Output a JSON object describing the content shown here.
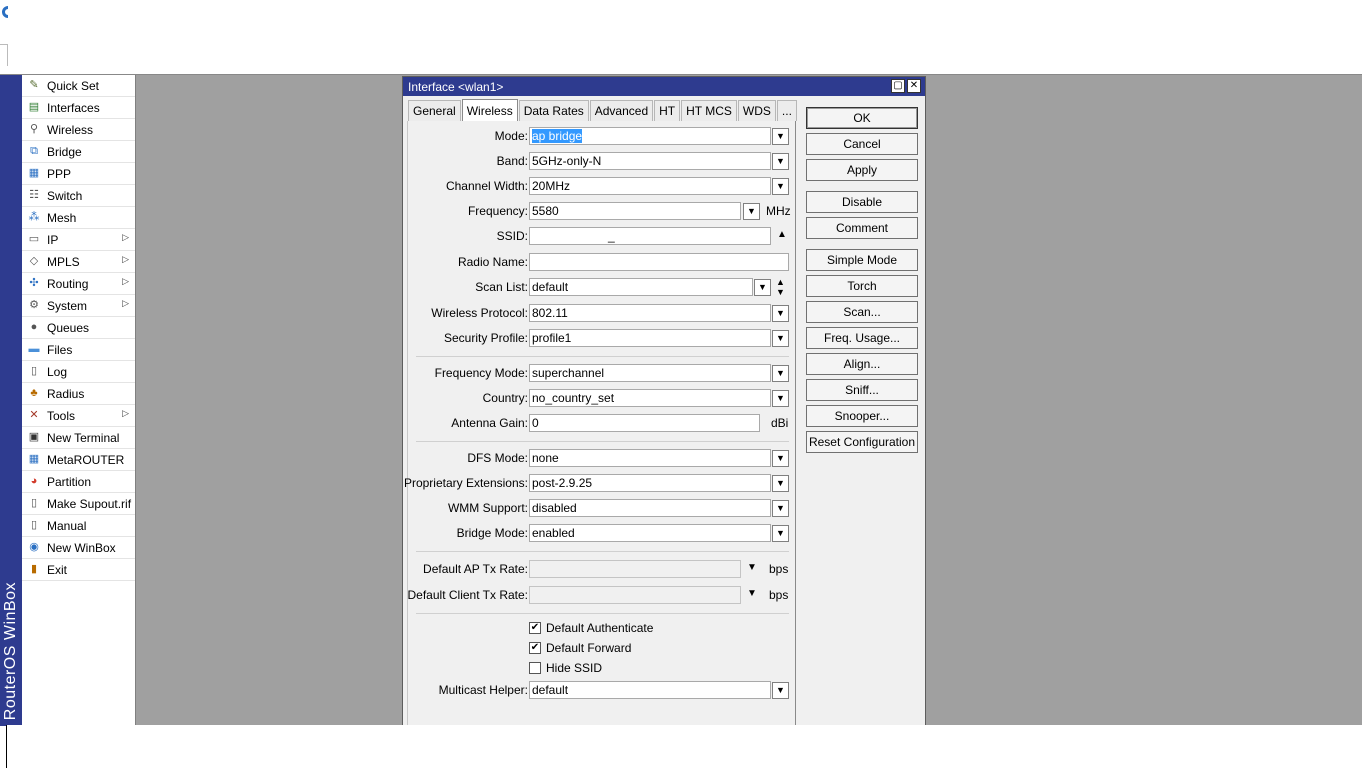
{
  "brand": "RouterOS WinBox",
  "menu": [
    {
      "label": "Quick Set",
      "icon": "quick-set-icon",
      "glyph": "✎",
      "color": "#556b2f",
      "arrow": false
    },
    {
      "label": "Interfaces",
      "icon": "interfaces-icon",
      "glyph": "▤",
      "color": "#2f7d32",
      "arrow": false
    },
    {
      "label": "Wireless",
      "icon": "wireless-icon",
      "glyph": "⚲",
      "color": "#555555",
      "arrow": false
    },
    {
      "label": "Bridge",
      "icon": "bridge-icon",
      "glyph": "⧉",
      "color": "#2a6fc2",
      "arrow": false
    },
    {
      "label": "PPP",
      "icon": "ppp-icon",
      "glyph": "▦",
      "color": "#2a6fc2",
      "arrow": false
    },
    {
      "label": "Switch",
      "icon": "switch-icon",
      "glyph": "☷",
      "color": "#555555",
      "arrow": false
    },
    {
      "label": "Mesh",
      "icon": "mesh-icon",
      "glyph": "⁂",
      "color": "#2a6fc2",
      "arrow": false
    },
    {
      "label": "IP",
      "icon": "ip-icon",
      "glyph": "▭",
      "color": "#555555",
      "arrow": true
    },
    {
      "label": "MPLS",
      "icon": "mpls-icon",
      "glyph": "◇",
      "color": "#555555",
      "arrow": true
    },
    {
      "label": "Routing",
      "icon": "routing-icon",
      "glyph": "✣",
      "color": "#2a6fc2",
      "arrow": true
    },
    {
      "label": "System",
      "icon": "system-icon",
      "glyph": "⚙",
      "color": "#555555",
      "arrow": true
    },
    {
      "label": "Queues",
      "icon": "queues-icon",
      "glyph": "●",
      "color": "#555555",
      "arrow": false
    },
    {
      "label": "Files",
      "icon": "files-icon",
      "glyph": "▬",
      "color": "#4a90d9",
      "arrow": false
    },
    {
      "label": "Log",
      "icon": "log-icon",
      "glyph": "▯",
      "color": "#555555",
      "arrow": false
    },
    {
      "label": "Radius",
      "icon": "radius-icon",
      "glyph": "♣",
      "color": "#b86b00",
      "arrow": false
    },
    {
      "label": "Tools",
      "icon": "tools-icon",
      "glyph": "✕",
      "color": "#a33a2a",
      "arrow": true
    },
    {
      "label": "New Terminal",
      "icon": "terminal-icon",
      "glyph": "▣",
      "color": "#333333",
      "arrow": false
    },
    {
      "label": "MetaROUTER",
      "icon": "metarouter-icon",
      "glyph": "▦",
      "color": "#2a6fc2",
      "arrow": false
    },
    {
      "label": "Partition",
      "icon": "partition-icon",
      "glyph": "◕",
      "color": "#d23c2c",
      "arrow": false
    },
    {
      "label": "Make Supout.rif",
      "icon": "supout-icon",
      "glyph": "▯",
      "color": "#555555",
      "arrow": false
    },
    {
      "label": "Manual",
      "icon": "manual-icon",
      "glyph": "▯",
      "color": "#555555",
      "arrow": false
    },
    {
      "label": "New WinBox",
      "icon": "winbox-icon",
      "glyph": "◉",
      "color": "#2a6fc2",
      "arrow": false
    },
    {
      "label": "Exit",
      "icon": "exit-icon",
      "glyph": "▮",
      "color": "#b86b00",
      "arrow": false
    }
  ],
  "window": {
    "title": "Interface <wlan1>",
    "tabs": [
      "General",
      "Wireless",
      "Data Rates",
      "Advanced",
      "HT",
      "HT MCS",
      "WDS",
      "..."
    ],
    "active_tab": "Wireless"
  },
  "form": {
    "mode": {
      "label": "Mode:",
      "value": "ap bridge"
    },
    "band": {
      "label": "Band:",
      "value": "5GHz-only-N"
    },
    "channel_width": {
      "label": "Channel Width:",
      "value": "20MHz"
    },
    "frequency": {
      "label": "Frequency:",
      "value": "5580",
      "unit": "MHz"
    },
    "ssid": {
      "label": "SSID:",
      "value": "_"
    },
    "radio_name": {
      "label": "Radio Name:",
      "value": ""
    },
    "scan_list": {
      "label": "Scan List:",
      "value": "default"
    },
    "wireless_protocol": {
      "label": "Wireless Protocol:",
      "value": "802.11"
    },
    "security_profile": {
      "label": "Security Profile:",
      "value": "profile1"
    },
    "frequency_mode": {
      "label": "Frequency Mode:",
      "value": "superchannel"
    },
    "country": {
      "label": "Country:",
      "value": "no_country_set"
    },
    "antenna_gain": {
      "label": "Antenna Gain:",
      "value": "0",
      "unit": "dBi"
    },
    "dfs_mode": {
      "label": "DFS Mode:",
      "value": "none"
    },
    "proprietary_extensions": {
      "label": "Proprietary Extensions:",
      "value": "post-2.9.25"
    },
    "wmm_support": {
      "label": "WMM Support:",
      "value": "disabled"
    },
    "bridge_mode": {
      "label": "Bridge Mode:",
      "value": "enabled"
    },
    "default_ap_tx_rate": {
      "label": "Default AP Tx Rate:",
      "value": "",
      "unit": "bps"
    },
    "default_client_tx_rate": {
      "label": "Default Client Tx Rate:",
      "value": "",
      "unit": "bps"
    },
    "default_authenticate": {
      "label": "Default Authenticate",
      "checked": true
    },
    "default_forward": {
      "label": "Default Forward",
      "checked": true
    },
    "hide_ssid": {
      "label": "Hide SSID",
      "checked": false
    },
    "multicast_helper": {
      "label": "Multicast Helper:",
      "value": "default"
    }
  },
  "buttons": {
    "ok": "OK",
    "cancel": "Cancel",
    "apply": "Apply",
    "disable": "Disable",
    "comment": "Comment",
    "simple_mode": "Simple Mode",
    "torch": "Torch",
    "scan": "Scan...",
    "freq_usage": "Freq. Usage...",
    "align": "Align...",
    "sniff": "Sniff...",
    "snooper": "Snooper...",
    "reset_configuration": "Reset Configuration"
  },
  "colors": {
    "title_bar": "#2e3b8f",
    "brand_bar": "#2e3b8f",
    "workspace": "#a0a0a0",
    "selection": "#3399ff"
  }
}
